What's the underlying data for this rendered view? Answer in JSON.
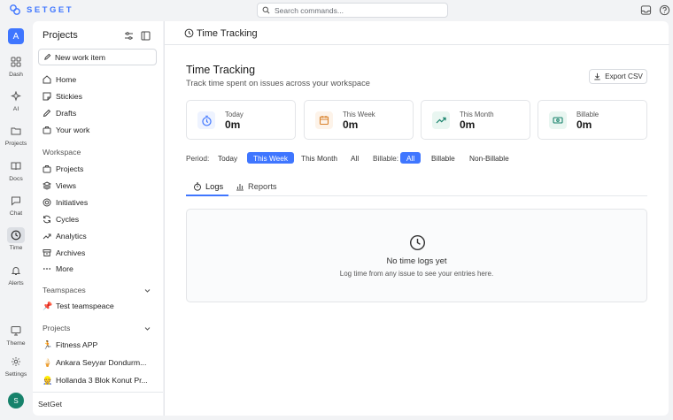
{
  "brand": {
    "name": "SETGET"
  },
  "search": {
    "placeholder": "Search commands..."
  },
  "workspace": {
    "initial": "A"
  },
  "user": {
    "initial": "S"
  },
  "rail": [
    {
      "label": "Dash",
      "icon": "dashboard-icon"
    },
    {
      "label": "AI",
      "icon": "sparkle-icon"
    },
    {
      "label": "Projects",
      "icon": "folder-icon"
    },
    {
      "label": "Docs",
      "icon": "book-icon"
    },
    {
      "label": "Chat",
      "icon": "chat-icon"
    },
    {
      "label": "Time",
      "icon": "clock-icon",
      "active": true
    },
    {
      "label": "Alerts",
      "icon": "bell-icon"
    },
    {
      "label": "Theme",
      "icon": "monitor-icon"
    },
    {
      "label": "Settings",
      "icon": "gear-icon"
    }
  ],
  "sidebar": {
    "title": "Projects",
    "new_item": "New work item",
    "nav": [
      "Home",
      "Stickies",
      "Drafts",
      "Your work"
    ],
    "workspace_label": "Workspace",
    "workspace_items": [
      "Projects",
      "Views",
      "Initiatives",
      "Cycles",
      "Analytics",
      "Archives",
      "More"
    ],
    "teamspaces_label": "Teamspaces",
    "teamspaces": [
      {
        "emoji": "📌",
        "name": "Test teamspeace"
      }
    ],
    "projects_label": "Projects",
    "projects": [
      {
        "emoji": "🏃",
        "name": "Fitness APP"
      },
      {
        "emoji": "🍦",
        "name": "Ankara Seyyar Dondurm..."
      },
      {
        "emoji": "👷",
        "name": "Hollanda 3 Blok Konut Pr..."
      }
    ],
    "footer": "SetGet"
  },
  "main": {
    "header_title": "Time Tracking",
    "title": "Time Tracking",
    "subtitle": "Track time spent on issues across your workspace",
    "export_label": "Export CSV",
    "cards": [
      {
        "label": "Today",
        "value": "0m",
        "icon": "timer-icon",
        "color": "#3f76ff",
        "bg": "#eef3ff"
      },
      {
        "label": "This Week",
        "value": "0m",
        "icon": "calendar-icon",
        "color": "#d9822b",
        "bg": "#fdf3e9"
      },
      {
        "label": "This Month",
        "value": "0m",
        "icon": "trending-up-icon",
        "color": "#17826b",
        "bg": "#e9f6f1"
      },
      {
        "label": "Billable",
        "value": "0m",
        "icon": "banknote-icon",
        "color": "#17826b",
        "bg": "#e9f6f1"
      }
    ],
    "period_label": "Period:",
    "periods": [
      "Today",
      "This Week",
      "This Month",
      "All"
    ],
    "period_selected": "This Week",
    "billable_label": "Billable:",
    "billable_options": [
      "All",
      "Billable",
      "Non-Billable"
    ],
    "billable_selected": "All",
    "tabs": [
      "Logs",
      "Reports"
    ],
    "active_tab": "Logs",
    "empty_title": "No time logs yet",
    "empty_subtitle": "Log time from any issue to see your entries here."
  },
  "colors": {
    "accent": "#3f76ff",
    "avatar": "#17826b"
  }
}
